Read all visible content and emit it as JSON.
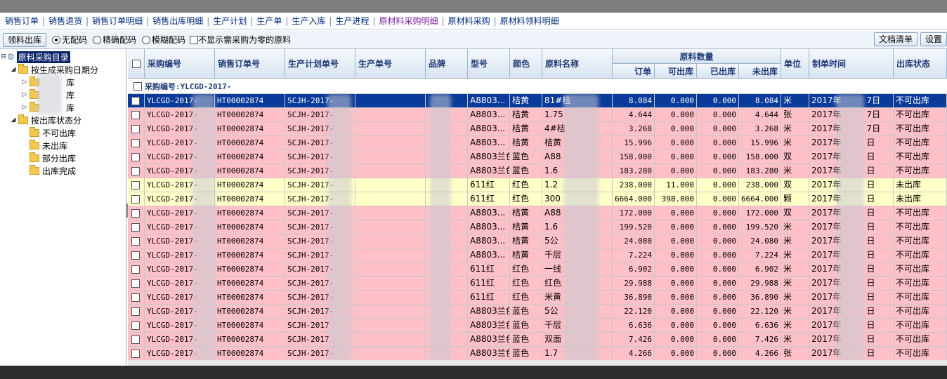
{
  "menu": [
    {
      "label": "销售订单",
      "active": false
    },
    {
      "label": "销售退货",
      "active": false
    },
    {
      "label": "销售订单明细",
      "active": false
    },
    {
      "label": "销售出库明细",
      "active": false
    },
    {
      "label": "生产计划",
      "active": false
    },
    {
      "label": "生产单",
      "active": false
    },
    {
      "label": "生产入库",
      "active": false
    },
    {
      "label": "生产进程",
      "active": false
    },
    {
      "label": "原材料采购明细",
      "active": true
    },
    {
      "label": "原材料采购",
      "active": false
    },
    {
      "label": "原材料领料明细",
      "active": false
    }
  ],
  "toolbar": {
    "issue_button": "领料出库",
    "radio_none": "无配码",
    "radio_exact": "精确配码",
    "radio_fuzzy": "模糊配码",
    "hide_zero_label": "不显示需采购为零的原料",
    "doc_list_button": "文档清单",
    "settings_button": "设置"
  },
  "tree": {
    "root": "原料采购目录",
    "by_date": "按生成采购日期分",
    "date_children": [
      "库",
      "库",
      "库"
    ],
    "by_status": "按出库状态分",
    "status_children": [
      "不可出库",
      "未出库",
      "部分出库",
      "出库完成"
    ]
  },
  "columns": {
    "code": "采购编号",
    "order": "销售订单号",
    "plan": "生产计划单号",
    "prod": "生产单号",
    "brand": "品牌",
    "model": "型号",
    "color": "颜色",
    "material": "原料名称",
    "qty_group": "原料数量",
    "qty_order": "订单",
    "qty_avail": "可出库",
    "qty_out": "已出库",
    "qty_pending": "未出库",
    "unit": "单位",
    "time": "制单时间",
    "status": "出库状态"
  },
  "group_label": "采购编号:YLCGD-2017-",
  "rows": [
    {
      "code": "YLCGD-2017-",
      "order": "HT00002874",
      "plan": "SCJH-2017-",
      "brand": "",
      "model": "A8803...",
      "color": "桔黄",
      "material": "81#桔",
      "o": "8.084",
      "a": "0.000",
      "d": "0.000",
      "p": "8.084",
      "unit": "米",
      "time": "2017年",
      "time2": "7日",
      "status": "不可出库",
      "style": "selected"
    },
    {
      "code": "YLCGD-2017-",
      "order": "HT00002874",
      "plan": "SCJH-2017-",
      "brand": "",
      "model": "A8803...",
      "color": "桔黄",
      "material": "1.75",
      "o": "4.644",
      "a": "0.000",
      "d": "0.000",
      "p": "4.644",
      "unit": "张",
      "time": "2017年",
      "time2": "7日",
      "status": "不可出库",
      "style": "pink"
    },
    {
      "code": "YLCGD-2017-",
      "order": "HT00002874",
      "plan": "SCJH-2017-",
      "brand": "",
      "model": "A8803...",
      "color": "桔黄",
      "material": "4#桔",
      "o": "3.268",
      "a": "0.000",
      "d": "0.000",
      "p": "3.268",
      "unit": "米",
      "time": "2017年",
      "time2": "7日",
      "status": "不可出库",
      "style": "pink"
    },
    {
      "code": "YLCGD-2017-",
      "order": "HT00002874",
      "plan": "SCJH-2017-",
      "brand": "",
      "model": "A8803...",
      "color": "桔黄",
      "material": "桔黄",
      "o": "15.996",
      "a": "0.000",
      "d": "0.000",
      "p": "15.996",
      "unit": "米",
      "time": "2017年",
      "time2": "日",
      "status": "不可出库",
      "style": "pink"
    },
    {
      "code": "YLCGD-2017-",
      "order": "HT00002874",
      "plan": "SCJH-2017-",
      "brand": "",
      "model": "A8803兰色",
      "color": "蓝色",
      "material": "A88",
      "o": "158.000",
      "a": "0.000",
      "d": "0.000",
      "p": "158.000",
      "unit": "双",
      "time": "2017年",
      "time2": "日",
      "status": "不可出库",
      "style": "pink"
    },
    {
      "code": "YLCGD-2017-",
      "order": "HT00002874",
      "plan": "SCJH-2017-",
      "brand": "",
      "model": "A8803兰色",
      "color": "蓝色",
      "material": "1.6",
      "o": "183.280",
      "a": "0.000",
      "d": "0.000",
      "p": "183.280",
      "unit": "米",
      "time": "2017年",
      "time2": "日",
      "status": "不可出库",
      "style": "pink"
    },
    {
      "code": "YLCGD-2017-",
      "order": "HT00002874",
      "plan": "SCJH-2017-",
      "brand": "",
      "model": "611红",
      "color": "红色",
      "material": "1.2",
      "o": "238.000",
      "a": "11.000",
      "d": "0.000",
      "p": "238.000",
      "unit": "双",
      "time": "2017年",
      "time2": "日",
      "status": "未出库",
      "style": "yellow"
    },
    {
      "code": "YLCGD-2017-",
      "order": "HT00002874",
      "plan": "SCJH-2017-",
      "brand": "",
      "model": "611红",
      "color": "红色",
      "material": "300",
      "o": "6664.000",
      "a": "398.000",
      "d": "0.000",
      "p": "6664.000",
      "unit": "颗",
      "time": "2017年",
      "time2": "日",
      "status": "未出库",
      "style": "yellow"
    },
    {
      "code": "YLCGD-2017-",
      "order": "HT00002874",
      "plan": "SCJH-2017-",
      "brand": "",
      "model": "A8803...",
      "color": "桔黄",
      "material": "A88",
      "o": "172.000",
      "a": "0.000",
      "d": "0.000",
      "p": "172.000",
      "unit": "双",
      "time": "2017年",
      "time2": "日",
      "status": "不可出库",
      "style": "pink"
    },
    {
      "code": "YLCGD-2017-",
      "order": "HT00002874",
      "plan": "SCJH-2017-",
      "brand": "",
      "model": "A8803...",
      "color": "桔黄",
      "material": "1.6",
      "o": "199.520",
      "a": "0.000",
      "d": "0.000",
      "p": "199.520",
      "unit": "米",
      "time": "2017年",
      "time2": "日",
      "status": "不可出库",
      "style": "pink"
    },
    {
      "code": "YLCGD-2017-",
      "order": "HT00002874",
      "plan": "SCJH-2017-",
      "brand": "",
      "model": "A8803...",
      "color": "桔黄",
      "material": "5公",
      "o": "24.080",
      "a": "0.000",
      "d": "0.000",
      "p": "24.080",
      "unit": "米",
      "time": "2017年",
      "time2": "日",
      "status": "不可出库",
      "style": "pink"
    },
    {
      "code": "YLCGD-2017-",
      "order": "HT00002874",
      "plan": "SCJH-2017-",
      "brand": "",
      "model": "A8803...",
      "color": "桔黄",
      "material": "千层",
      "o": "7.224",
      "a": "0.000",
      "d": "0.000",
      "p": "7.224",
      "unit": "米",
      "time": "2017年",
      "time2": "日",
      "status": "不可出库",
      "style": "pink"
    },
    {
      "code": "YLCGD-2017-",
      "order": "HT00002874",
      "plan": "SCJH-2017-",
      "brand": "",
      "model": "611红",
      "color": "红色",
      "material": "一线",
      "o": "6.902",
      "a": "0.000",
      "d": "0.000",
      "p": "6.902",
      "unit": "米",
      "time": "2017年",
      "time2": "日",
      "status": "不可出库",
      "style": "pink"
    },
    {
      "code": "YLCGD-2017-",
      "order": "HT00002874",
      "plan": "SCJH-2017-",
      "brand": "",
      "model": "611红",
      "color": "红色",
      "material": "红色",
      "o": "29.988",
      "a": "0.000",
      "d": "0.000",
      "p": "29.988",
      "unit": "米",
      "time": "2017年",
      "time2": "日",
      "status": "不可出库",
      "style": "pink"
    },
    {
      "code": "YLCGD-2017-",
      "order": "HT00002874",
      "plan": "SCJH-2017-",
      "brand": "",
      "model": "611红",
      "color": "红色",
      "material": "米黄",
      "o": "36.890",
      "a": "0.000",
      "d": "0.000",
      "p": "36.890",
      "unit": "米",
      "time": "2017年",
      "time2": "日",
      "status": "不可出库",
      "style": "pink"
    },
    {
      "code": "YLCGD-2017-",
      "order": "HT00002874",
      "plan": "SCJH-2017-",
      "brand": "",
      "model": "A8803兰色",
      "color": "蓝色",
      "material": "5公",
      "o": "22.120",
      "a": "0.000",
      "d": "0.000",
      "p": "22.120",
      "unit": "米",
      "time": "2017年",
      "time2": "日",
      "status": "不可出库",
      "style": "pink"
    },
    {
      "code": "YLCGD-2017-",
      "order": "HT00002874",
      "plan": "SCJH-2017",
      "brand": "",
      "model": "A8803兰色",
      "color": "蓝色",
      "material": "千层",
      "o": "6.636",
      "a": "0.000",
      "d": "0.000",
      "p": "6.636",
      "unit": "米",
      "time": "2017年",
      "time2": "日",
      "status": "不可出库",
      "style": "pink"
    },
    {
      "code": "YLCGD-2017-",
      "order": "HT00002874",
      "plan": "SCJH-2017",
      "brand": "",
      "model": "A8803兰色",
      "color": "蓝色",
      "material": "双面",
      "o": "7.426",
      "a": "0.000",
      "d": "0.000",
      "p": "7.426",
      "unit": "米",
      "time": "2017年",
      "time2": "日",
      "status": "不可出库",
      "style": "pink"
    },
    {
      "code": "YLCGD-2017-",
      "order": "HT00002874",
      "plan": "SCJH-2017-",
      "brand": "",
      "model": "A8803兰色",
      "color": "蓝色",
      "material": "1.7",
      "o": "4.266",
      "a": "0.000",
      "d": "0.000",
      "p": "4.266",
      "unit": "张",
      "time": "2017年",
      "time2": "日",
      "status": "不可出库",
      "style": "pink"
    }
  ]
}
